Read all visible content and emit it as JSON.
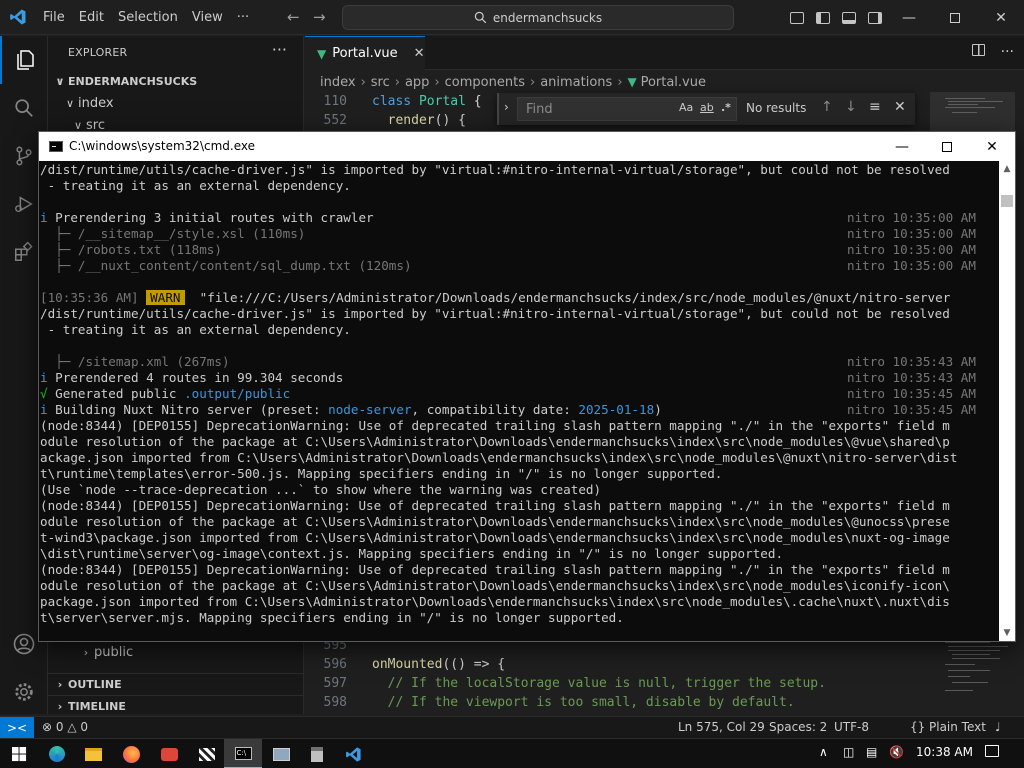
{
  "titlebar": {
    "menu": [
      "File",
      "Edit",
      "Selection",
      "View",
      "···"
    ],
    "search": "endermanchsucks"
  },
  "sidebar": {
    "title": "EXPLORER",
    "more": "···",
    "root": "ENDERMANCHSUCKS",
    "items": [
      "index",
      "src",
      "public"
    ],
    "outline": "OUTLINE",
    "timeline": "TIMELINE"
  },
  "editor": {
    "tab": "Portal.vue",
    "breadcrumb": [
      "index",
      "src",
      "app",
      "components",
      "animations",
      "Portal.vue"
    ],
    "find": {
      "placeholder": "Find",
      "result": "No results",
      "case": "Aa",
      "word": "ab",
      "regex": ".*"
    },
    "lines": [
      {
        "n": "110",
        "parts": [
          [
            "kw",
            "class "
          ],
          [
            "cls",
            "Portal"
          ],
          [
            "pn",
            " {"
          ]
        ]
      },
      {
        "n": "552",
        "parts": [
          [
            "fn",
            "  render"
          ],
          [
            "pn",
            "() {"
          ]
        ]
      },
      {
        "n": "595",
        "parts": []
      },
      {
        "n": "596",
        "parts": [
          [
            "fn",
            "onMounted"
          ],
          [
            "pn",
            "(() => {"
          ]
        ]
      },
      {
        "n": "597",
        "parts": [
          [
            "cm",
            "  // If the localStorage value is null, trigger the setup."
          ]
        ]
      },
      {
        "n": "598",
        "parts": [
          [
            "cm",
            "  // If the viewport is too small, disable by default."
          ]
        ]
      }
    ]
  },
  "statusbar": {
    "problems_errors": "0",
    "problems_warnings": "0",
    "position": "Ln 575, Col 29",
    "spaces": "Spaces: 2",
    "encoding": "UTF-8",
    "braces": "{}",
    "language": "Plain Text"
  },
  "cmd": {
    "title": "C:\\windows\\system32\\cmd.exe",
    "lines": [
      {
        "t": "/dist/runtime/utils/cache-driver.js\" is imported by \"virtual:#nitro-internal-virtual/storage\", but could not be resolved"
      },
      {
        "t": " - treating it as an external dependency."
      },
      {
        "t": ""
      },
      {
        "segs": [
          [
            "cyan",
            "i"
          ],
          [
            "",
            " Prerendering 3 initial routes with crawler"
          ]
        ],
        "r": "nitro 10:35:00 AM"
      },
      {
        "segs": [
          [
            "dim",
            "  ├─ /__sitemap__/style.xsl (110ms)"
          ]
        ],
        "r": "nitro 10:35:00 AM"
      },
      {
        "segs": [
          [
            "dim",
            "  ├─ /robots.txt (118ms)"
          ]
        ],
        "r": "nitro 10:35:00 AM"
      },
      {
        "segs": [
          [
            "dim",
            "  ├─ /__nuxt_content/content/sql_dump.txt (120ms)"
          ]
        ],
        "r": "nitro 10:35:00 AM"
      },
      {
        "t": ""
      },
      {
        "segs": [
          [
            "dim",
            "[10:35:36 AM] "
          ],
          [
            "warn",
            "WARN"
          ],
          [
            "",
            "  \"file:///C:/Users/Administrator/Downloads/endermanchsucks/index/src/node_modules/@nuxt/nitro-server"
          ]
        ]
      },
      {
        "t": "/dist/runtime/utils/cache-driver.js\" is imported by \"virtual:#nitro-internal-virtual/storage\", but could not be resolved"
      },
      {
        "t": " - treating it as an external dependency."
      },
      {
        "t": ""
      },
      {
        "segs": [
          [
            "dim",
            "  ├─ /sitemap.xml (267ms)"
          ]
        ],
        "r": "nitro 10:35:43 AM"
      },
      {
        "segs": [
          [
            "cyan",
            "i"
          ],
          [
            "",
            " Prerendered 4 routes in 99.304 seconds"
          ]
        ],
        "r": "nitro 10:35:43 AM"
      },
      {
        "segs": [
          [
            "grn",
            "√"
          ],
          [
            "",
            " Generated public "
          ],
          [
            "cyan",
            ".output/public"
          ]
        ],
        "r": "nitro 10:35:45 AM"
      },
      {
        "segs": [
          [
            "cyan",
            "i"
          ],
          [
            "",
            " Building Nuxt Nitro server (preset: "
          ],
          [
            "cyan",
            "node-server"
          ],
          [
            "",
            ", compatibility date: "
          ],
          [
            "cyan",
            "2025-01-18"
          ],
          [
            "",
            ")"
          ]
        ],
        "r": "nitro 10:35:45 AM"
      },
      {
        "t": "(node:8344) [DEP0155] DeprecationWarning: Use of deprecated trailing slash pattern mapping \"./\" in the \"exports\" field m"
      },
      {
        "t": "odule resolution of the package at C:\\Users\\Administrator\\Downloads\\endermanchsucks\\index\\src\\node_modules\\@vue\\shared\\p"
      },
      {
        "t": "ackage.json imported from C:\\Users\\Administrator\\Downloads\\endermanchsucks\\index\\src\\node_modules\\@nuxt\\nitro-server\\dist"
      },
      {
        "t": "t\\runtime\\templates\\error-500.js. Mapping specifiers ending in \"/\" is no longer supported."
      },
      {
        "t": "(Use `node --trace-deprecation ...` to show where the warning was created)"
      },
      {
        "t": "(node:8344) [DEP0155] DeprecationWarning: Use of deprecated trailing slash pattern mapping \"./\" in the \"exports\" field m"
      },
      {
        "t": "odule resolution of the package at C:\\Users\\Administrator\\Downloads\\endermanchsucks\\index\\src\\node_modules\\@unocss\\prese"
      },
      {
        "t": "t-wind3\\package.json imported from C:\\Users\\Administrator\\Downloads\\endermanchsucks\\index\\src\\node_modules\\nuxt-og-image"
      },
      {
        "t": "\\dist\\runtime\\server\\og-image\\context.js. Mapping specifiers ending in \"/\" is no longer supported."
      },
      {
        "t": "(node:8344) [DEP0155] DeprecationWarning: Use of deprecated trailing slash pattern mapping \"./\" in the \"exports\" field m"
      },
      {
        "t": "odule resolution of the package at C:\\Users\\Administrator\\Downloads\\endermanchsucks\\index\\src\\node_modules\\iconify-icon\\"
      },
      {
        "t": "package.json imported from C:\\Users\\Administrator\\Downloads\\endermanchsucks\\index\\src\\node_modules\\.cache\\nuxt\\.nuxt\\dis"
      },
      {
        "t": "t\\server\\server.mjs. Mapping specifiers ending in \"/\" is no longer supported."
      }
    ]
  },
  "taskbar": {
    "time": "10:38 AM",
    "apps": [
      "edge-icon",
      "file-explorer-icon",
      "firefox-icon",
      "app-icon",
      "clapper-icon",
      "cmd-icon",
      "network-app-icon",
      "usb-app-icon",
      "vscode-icon"
    ]
  },
  "colors": {
    "accent": "#0078d4",
    "warn": "#c19c00",
    "vue": "#41b883"
  }
}
